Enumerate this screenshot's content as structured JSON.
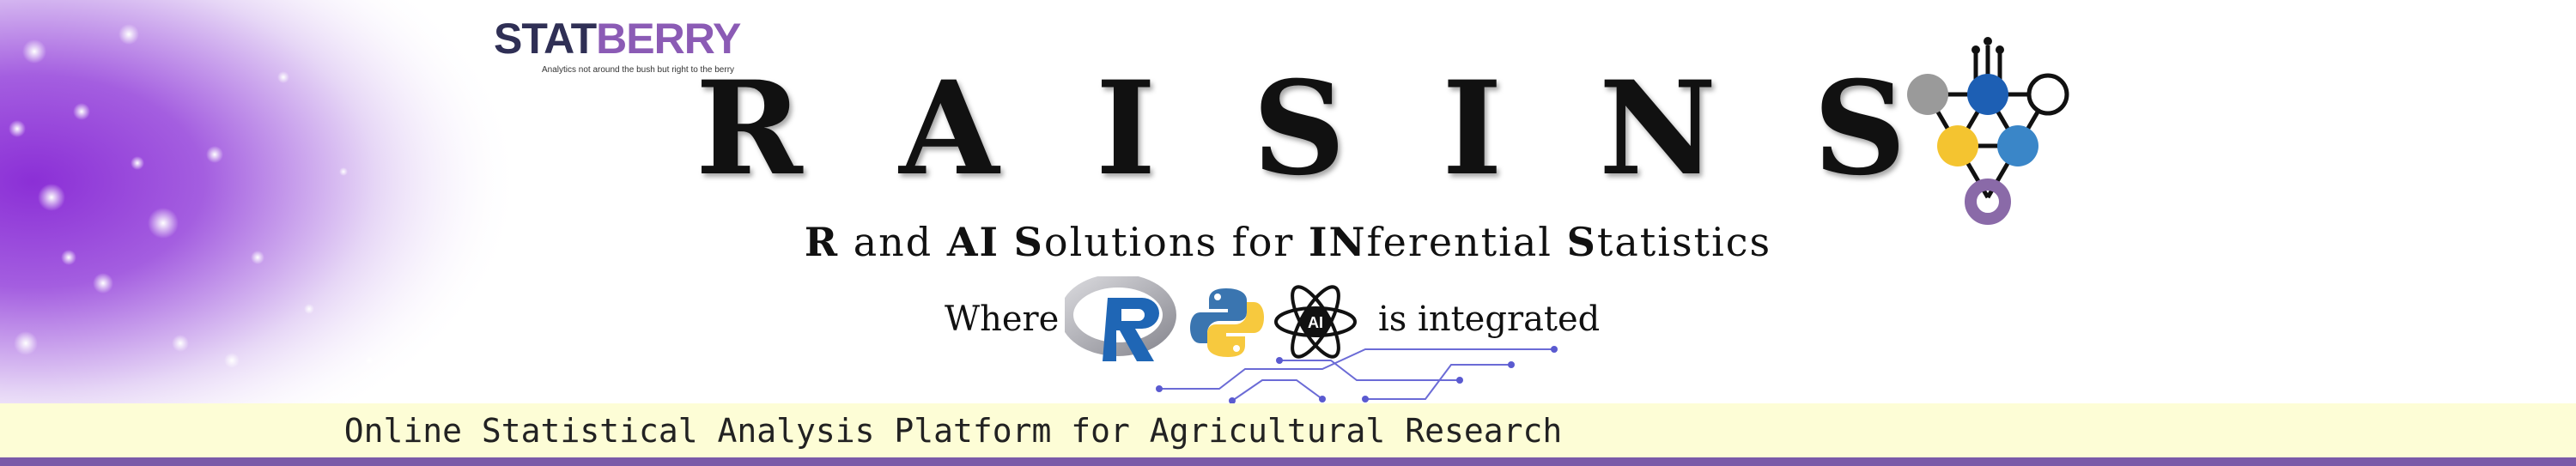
{
  "brand": {
    "logo_part1": "STAT",
    "logo_part2": "BERRY",
    "logo_tagline": "Analytics not around the bush but right to the berry"
  },
  "title": {
    "letters": [
      "R",
      "A",
      "I",
      "S",
      "I",
      "N",
      "S"
    ]
  },
  "subtitle": {
    "parts": [
      {
        "bold": "R",
        "rest": " and "
      },
      {
        "bold": "AI",
        "rest": " "
      },
      {
        "bold": "S",
        "rest": "olutions for "
      },
      {
        "bold": "IN",
        "rest": "ferential "
      },
      {
        "bold": "S",
        "rest": "tatistics"
      }
    ]
  },
  "integration": {
    "prefix": "Where",
    "suffix": "is integrated",
    "ai_badge": "AI"
  },
  "icons": [
    "purple-sparkle-background",
    "statoberry-logo",
    "raisins-molecule-icon",
    "r-logo-icon",
    "python-logo-icon",
    "ai-atom-icon",
    "circuit-lines-icon"
  ],
  "tagline": "Online Statistical Analysis Platform for Agricultural Research",
  "colors": {
    "purple": "#8b2fd6",
    "tagline_bg": "#fdfdd6",
    "bottom_line": "#7a5aa8",
    "molecule_blue": "#1d5fb4",
    "molecule_yellow": "#f4c430",
    "molecule_lightblue": "#3a86c8",
    "molecule_gray": "#9a9a9a",
    "molecule_purple": "#8a6aa8"
  }
}
